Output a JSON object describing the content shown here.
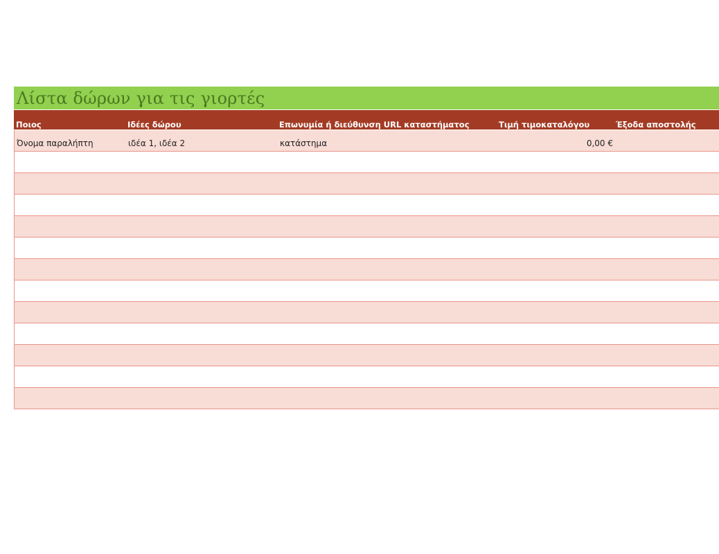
{
  "title": "Λίστα δώρων για τις γιορτές",
  "columns": {
    "who": "Ποιος",
    "ideas": "Ιδέες δώρου",
    "store": "Επωνυμία ή διεύθυνση URL καταστήματος",
    "price": "Τιμή τιμοκαταλόγου",
    "shipping": "Έξοδα αποστολής"
  },
  "rows": [
    {
      "who": "Όνομα παραλήπτη",
      "ideas": "ιδέα 1, ιδέα 2",
      "store": "κατάστημα",
      "price": "0,00 €",
      "shipping": ""
    },
    {
      "who": "",
      "ideas": "",
      "store": "",
      "price": "",
      "shipping": ""
    },
    {
      "who": "",
      "ideas": "",
      "store": "",
      "price": "",
      "shipping": ""
    },
    {
      "who": "",
      "ideas": "",
      "store": "",
      "price": "",
      "shipping": ""
    },
    {
      "who": "",
      "ideas": "",
      "store": "",
      "price": "",
      "shipping": ""
    },
    {
      "who": "",
      "ideas": "",
      "store": "",
      "price": "",
      "shipping": ""
    },
    {
      "who": "",
      "ideas": "",
      "store": "",
      "price": "",
      "shipping": ""
    },
    {
      "who": "",
      "ideas": "",
      "store": "",
      "price": "",
      "shipping": ""
    },
    {
      "who": "",
      "ideas": "",
      "store": "",
      "price": "",
      "shipping": ""
    },
    {
      "who": "",
      "ideas": "",
      "store": "",
      "price": "",
      "shipping": ""
    },
    {
      "who": "",
      "ideas": "",
      "store": "",
      "price": "",
      "shipping": ""
    },
    {
      "who": "",
      "ideas": "",
      "store": "",
      "price": "",
      "shipping": ""
    },
    {
      "who": "",
      "ideas": "",
      "store": "",
      "price": "",
      "shipping": ""
    }
  ],
  "colors": {
    "title_bg": "#92d050",
    "title_text": "#4a7a1e",
    "header_bg": "#a33b24",
    "band_fill": "#f8dcd6",
    "row_border": "#e8958a"
  }
}
